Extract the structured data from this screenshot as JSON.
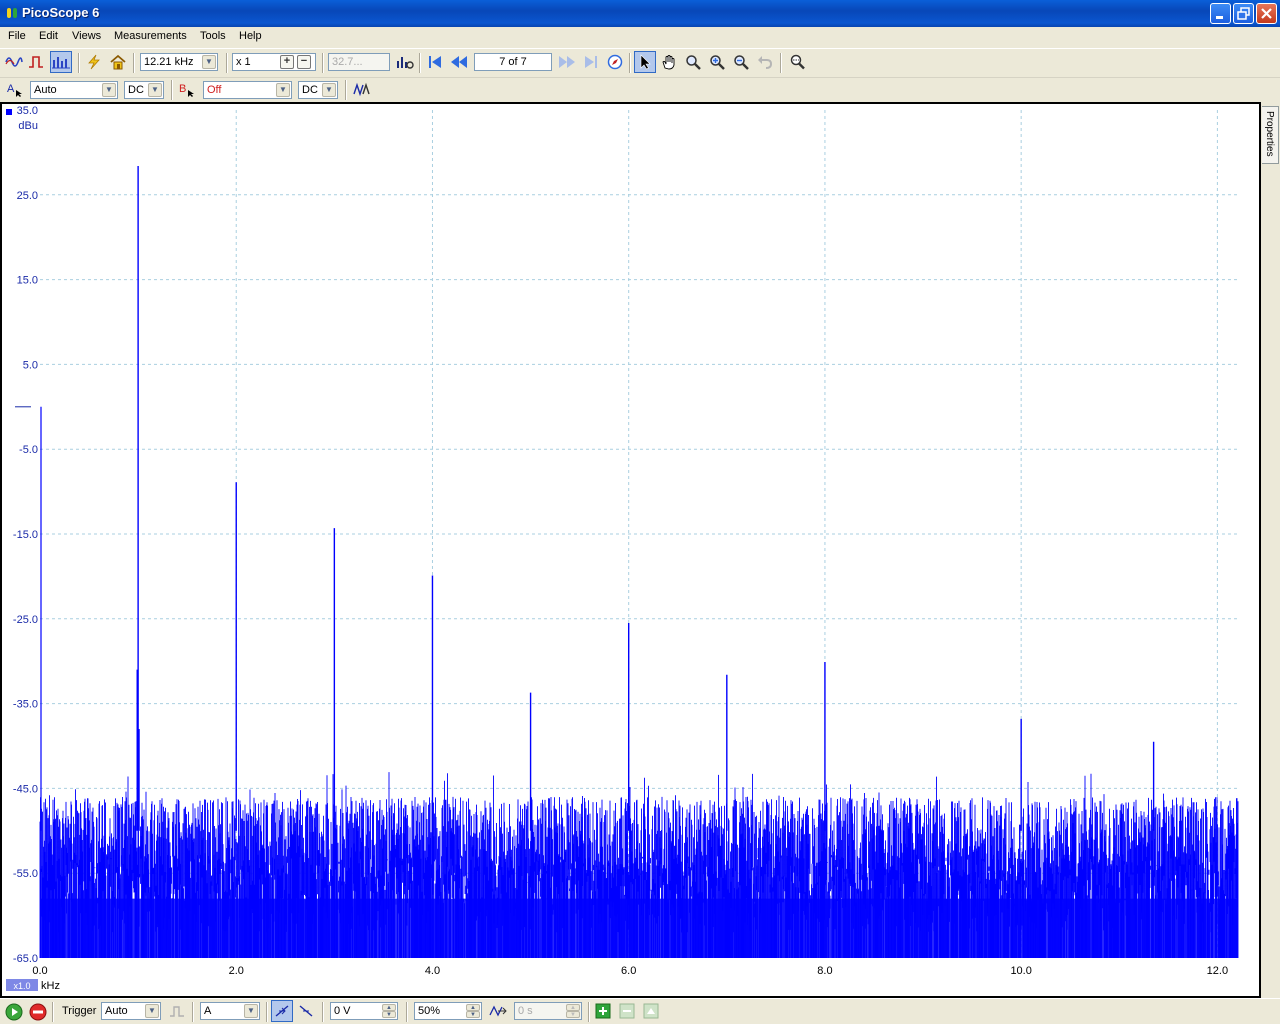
{
  "window": {
    "title": "PicoScope 6"
  },
  "menu": [
    "File",
    "Edit",
    "Views",
    "Measurements",
    "Tools",
    "Help"
  ],
  "toolbar": {
    "frequency": "12.21 kHz",
    "zoom": "x 1",
    "capture_count_value": "32.7...",
    "buffer_position": "7 of 7"
  },
  "channel_a": {
    "label": "A",
    "range": "Auto",
    "coupling": "DC"
  },
  "channel_b": {
    "label": "B",
    "range": "Off",
    "coupling": "DC"
  },
  "sidebar": {
    "properties_tab": "Properties"
  },
  "plot": {
    "y_unit": "dBu",
    "x_unit": "kHz",
    "x_scale_badge": "x1.0",
    "y_ticks": [
      "35.0",
      "25.0",
      "15.0",
      "5.0",
      "-5.0",
      "-15.0",
      "-25.0",
      "-35.0",
      "-45.0",
      "-55.0",
      "-65.0"
    ],
    "x_ticks": [
      "0.0",
      "2.0",
      "4.0",
      "6.0",
      "8.0",
      "10.0",
      "12.0"
    ]
  },
  "chart_data": {
    "type": "line",
    "title": "",
    "xlabel": "kHz",
    "ylabel": "dBu",
    "xlim": [
      0,
      12.21
    ],
    "ylim": [
      -65,
      35
    ],
    "grid": true,
    "series": [
      {
        "color": "#0000ff",
        "noise_floor_range": [
          -65,
          -46
        ],
        "peaks": [
          {
            "x": 1.0,
            "y": 28.4
          },
          {
            "x": 2.0,
            "y": -8.9
          },
          {
            "x": 3.0,
            "y": -14.3
          },
          {
            "x": 4.0,
            "y": -19.9
          },
          {
            "x": 5.0,
            "y": -33.7
          },
          {
            "x": 6.0,
            "y": -25.5
          },
          {
            "x": 7.0,
            "y": -31.6
          },
          {
            "x": 8.0,
            "y": -30.1
          },
          {
            "x": 10.0,
            "y": -36.8
          },
          {
            "x": 11.35,
            "y": -39.5
          }
        ]
      }
    ]
  },
  "statusbar": {
    "trigger_label": "Trigger",
    "trigger_mode": "Auto",
    "trigger_source": "A",
    "threshold": "0 V",
    "pre_trigger": "50%",
    "delay": "0 s"
  },
  "colors": {
    "trace": "#0000ff",
    "grid": "#a9cfe0",
    "accent": "#316ac5"
  }
}
